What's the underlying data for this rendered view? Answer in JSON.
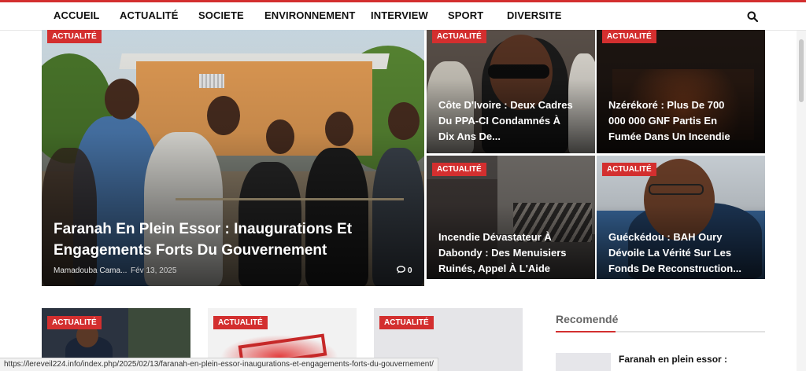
{
  "nav": {
    "items": [
      "ACCUEIL",
      "ACTUALITÉ",
      "SOCIETE",
      "ENVIRONNEMENT",
      "INTERVIEW",
      "SPORT",
      "DIVERSITE"
    ]
  },
  "featured": {
    "badge": "ACTUALITÉ",
    "title_line1": "Faranah En Plein Essor : Inaugurations Et",
    "title_line2": "Engagements Forts Du Gouvernement",
    "author": "Mamadouba Cama...",
    "date": "Fév 13, 2025",
    "comments": "0"
  },
  "tiles": [
    {
      "badge": "ACTUALITÉ",
      "line1": "Côte D'Ivoire : Deux Cadres",
      "line2": "Du PPA-CI Condamnés À",
      "line3": "Dix Ans De..."
    },
    {
      "badge": "ACTUALITÉ",
      "line1": "Nzérékoré : Plus De 700",
      "line2": "000 000 GNF Partis En",
      "line3": "Fumée Dans Un Incendie"
    },
    {
      "badge": "ACTUALITÉ",
      "line1": "Incendie Dévastateur À",
      "line2": "Dabondy : Des Menuisiers",
      "line3": "Ruinés, Appel À L'Aide"
    },
    {
      "badge": "ACTUALITÉ",
      "line1": "Guéckédou : BAH Oury",
      "line2": "Dévoile La Vérité Sur Les",
      "line3": "Fonds De Reconstruction..."
    }
  ],
  "cards": [
    {
      "badge": "ACTUALITÉ"
    },
    {
      "badge": "ACTUALITÉ"
    },
    {
      "badge": "ACTUALITÉ"
    }
  ],
  "sidebar": {
    "title": "Recomendé",
    "link": "Faranah en plein essor :"
  },
  "status_url": "https://lereveil224.info/index.php/2025/02/13/faranah-en-plein-essor-inaugurations-et-engagements-forts-du-gouvernement/",
  "colors": {
    "accent": "#d32f2f"
  },
  "icons": {
    "search": "search-icon",
    "comments": "comment-icon"
  }
}
